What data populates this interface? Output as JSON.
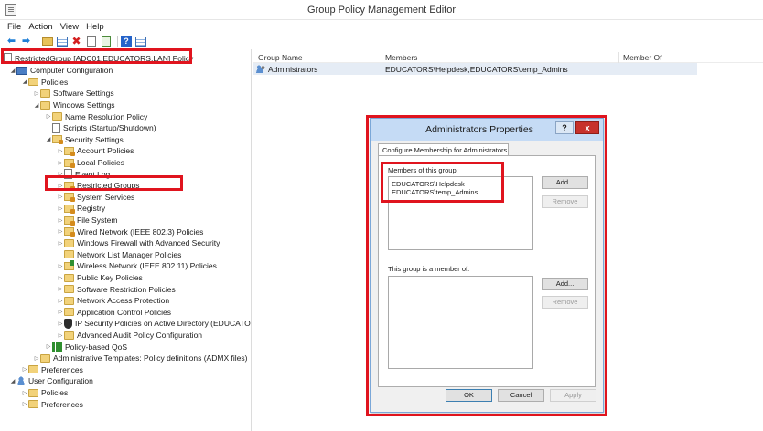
{
  "window": {
    "title": "Group Policy Management Editor"
  },
  "menu": [
    "File",
    "Action",
    "View",
    "Help"
  ],
  "toolbar": [
    "back-arrow-icon",
    "forward-arrow-icon",
    "up-folder-icon",
    "show-pane-icon",
    "delete-icon",
    "properties-icon",
    "export-icon",
    "help-icon",
    "console-icon"
  ],
  "tree": {
    "root": "RestrictedGroup [ADC01.EDUCATORS.LAN] Policy",
    "items": [
      {
        "label": "Computer Configuration",
        "icon": "computer-icon",
        "level": 1,
        "toggle": "expanded"
      },
      {
        "label": "Policies",
        "icon": "folder-icon",
        "level": 2,
        "toggle": "expanded"
      },
      {
        "label": "Software Settings",
        "icon": "folder-icon",
        "level": 3,
        "toggle": "collapsed"
      },
      {
        "label": "Windows Settings",
        "icon": "folder-icon",
        "level": 3,
        "toggle": "expanded"
      },
      {
        "label": "Name Resolution Policy",
        "icon": "folder-icon",
        "level": 4,
        "toggle": "collapsed"
      },
      {
        "label": "Scripts (Startup/Shutdown)",
        "icon": "document-icon",
        "level": 4,
        "toggle": "none"
      },
      {
        "label": "Security Settings",
        "icon": "folder-lock-icon",
        "level": 4,
        "toggle": "expanded"
      },
      {
        "label": "Account Policies",
        "icon": "folder-lock-icon",
        "level": 5,
        "toggle": "collapsed"
      },
      {
        "label": "Local Policies",
        "icon": "folder-lock-icon",
        "level": 5,
        "toggle": "collapsed"
      },
      {
        "label": "Event Log",
        "icon": "document-icon",
        "level": 5,
        "toggle": "collapsed"
      },
      {
        "label": "Restricted Groups",
        "icon": "folder-lock-icon",
        "level": 5,
        "toggle": "collapsed"
      },
      {
        "label": "System Services",
        "icon": "folder-lock-icon",
        "level": 5,
        "toggle": "collapsed"
      },
      {
        "label": "Registry",
        "icon": "folder-lock-icon",
        "level": 5,
        "toggle": "collapsed"
      },
      {
        "label": "File System",
        "icon": "folder-lock-icon",
        "level": 5,
        "toggle": "collapsed"
      },
      {
        "label": "Wired Network (IEEE 802.3) Policies",
        "icon": "folder-lock-icon",
        "level": 5,
        "toggle": "collapsed"
      },
      {
        "label": "Windows Firewall with Advanced Security",
        "icon": "folder-icon",
        "level": 5,
        "toggle": "collapsed"
      },
      {
        "label": "Network List Manager Policies",
        "icon": "folder-icon",
        "level": 5,
        "toggle": "none"
      },
      {
        "label": "Wireless Network (IEEE 802.11) Policies",
        "icon": "wifi-icon",
        "level": 5,
        "toggle": "collapsed"
      },
      {
        "label": "Public Key Policies",
        "icon": "folder-icon",
        "level": 5,
        "toggle": "collapsed"
      },
      {
        "label": "Software Restriction Policies",
        "icon": "folder-icon",
        "level": 5,
        "toggle": "collapsed"
      },
      {
        "label": "Network Access Protection",
        "icon": "folder-icon",
        "level": 5,
        "toggle": "collapsed"
      },
      {
        "label": "Application Control Policies",
        "icon": "folder-icon",
        "level": 5,
        "toggle": "collapsed"
      },
      {
        "label": "IP Security Policies on Active Directory (EDUCATO",
        "icon": "shield-icon",
        "level": 5,
        "toggle": "collapsed"
      },
      {
        "label": "Advanced Audit Policy Configuration",
        "icon": "folder-icon",
        "level": 5,
        "toggle": "collapsed"
      },
      {
        "label": "Policy-based QoS",
        "icon": "chart-icon",
        "level": 4,
        "toggle": "collapsed"
      },
      {
        "label": "Administrative Templates: Policy definitions (ADMX files)",
        "icon": "folder-icon",
        "level": 3,
        "toggle": "collapsed"
      },
      {
        "label": "Preferences",
        "icon": "folder-icon",
        "level": 2,
        "toggle": "collapsed"
      },
      {
        "label": "User Configuration",
        "icon": "user-icon",
        "level": 1,
        "toggle": "expanded"
      },
      {
        "label": "Policies",
        "icon": "folder-icon",
        "level": 2,
        "toggle": "collapsed"
      },
      {
        "label": "Preferences",
        "icon": "folder-icon",
        "level": 2,
        "toggle": "collapsed"
      }
    ]
  },
  "list": {
    "columns": [
      "Group Name",
      "Members",
      "Member Of"
    ],
    "rows": [
      {
        "group": "Administrators",
        "members": "EDUCATORS\\Helpdesk,EDUCATORS\\temp_Admins",
        "member_of": ""
      }
    ]
  },
  "dialog": {
    "title": "Administrators Properties",
    "help": "?",
    "close": "x",
    "tab": "Configure Membership for Administrators",
    "members_label": "Members of this group:",
    "members": [
      "EDUCATORS\\Helpdesk",
      "EDUCATORS\\temp_Admins"
    ],
    "member_of_label": "This group is a member of:",
    "member_of": [],
    "add_label": "Add...",
    "remove_label": "Remove",
    "ok_label": "OK",
    "cancel_label": "Cancel",
    "apply_label": "Apply"
  },
  "colors": {
    "highlight_box": "#e0141e",
    "selected_row": "#e5ecf5",
    "dialog_title": "#c5dbf5"
  }
}
